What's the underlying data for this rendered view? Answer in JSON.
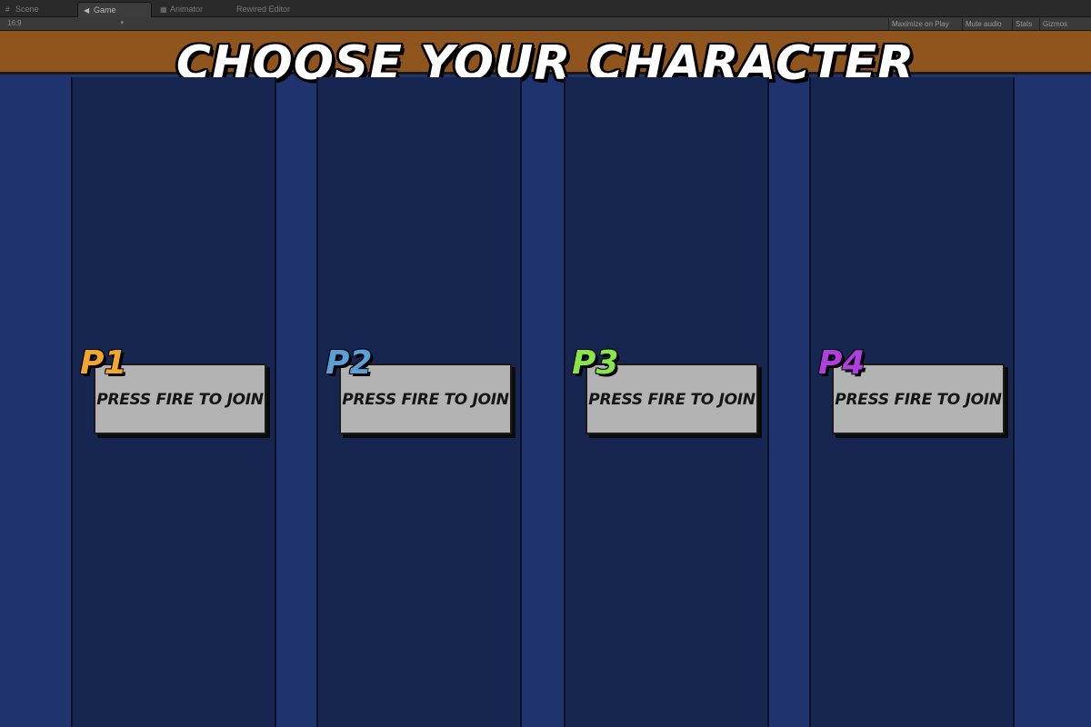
{
  "editor": {
    "tabs": [
      {
        "label": "Scene",
        "icon": "scene-icon"
      },
      {
        "label": "Game",
        "icon": "game-icon"
      },
      {
        "label": "Animator",
        "icon": "animator-icon"
      },
      {
        "label": "Rewired Editor",
        "icon": ""
      }
    ],
    "toolbar": {
      "aspect": "16:9",
      "maximize_on_play": "Maximize on Play",
      "mute_audio": "Mute audio",
      "stats": "Stats",
      "gizmos": "Gizmos"
    }
  },
  "game": {
    "title": "CHOOSE YOUR CHARACTER",
    "colors": {
      "header": "#8f551d",
      "background": "#1f346e",
      "panel": "#172650",
      "join_box": "#b3b3b3"
    },
    "players": [
      {
        "label": "P1",
        "join_text": "PRESS FIRE TO JOIN",
        "color": "#f2a531"
      },
      {
        "label": "P2",
        "join_text": "PRESS FIRE TO JOIN",
        "color": "#5aa0d6"
      },
      {
        "label": "P3",
        "join_text": "PRESS FIRE TO JOIN",
        "color": "#86e64a"
      },
      {
        "label": "P4",
        "join_text": "PRESS FIRE TO JOIN",
        "color": "#b03ee0"
      }
    ]
  }
}
